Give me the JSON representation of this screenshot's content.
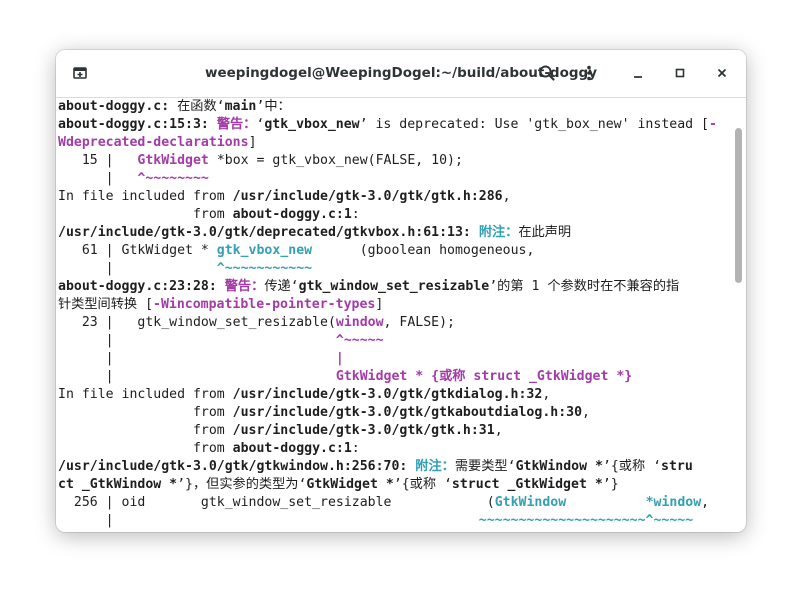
{
  "window": {
    "title": "weepingdogel@WeepingDogel:~/build/about-doggy",
    "new_tab_icon": "new-tab-icon",
    "search_icon": "search-icon",
    "menu_icon": "kebab-menu-icon",
    "minimize_icon": "minimize-icon",
    "maximize_icon": "maximize-icon",
    "close_icon": "close-icon"
  },
  "colors": {
    "warning": "#a33ba8",
    "note": "#33a0b3",
    "text": "#1e1e1e"
  },
  "terminal": {
    "lines": [
      [
        {
          "t": "about-doggy.c:",
          "c": "b"
        },
        {
          "t": " 在函数‘"
        },
        {
          "t": "main",
          "c": "b"
        },
        {
          "t": "’中："
        }
      ],
      [
        {
          "t": "about-doggy.c:15:3:",
          "c": "b"
        },
        {
          "t": " "
        },
        {
          "t": "警告：",
          "c": "warn"
        },
        {
          "t": "‘"
        },
        {
          "t": "gtk_vbox_new",
          "c": "b"
        },
        {
          "t": "’ is deprecated: Use 'gtk_box_new' instead ["
        },
        {
          "t": "-",
          "c": "magb"
        }
      ],
      [
        {
          "t": "Wdeprecated-declarations",
          "c": "magb"
        },
        {
          "t": "]"
        }
      ],
      [
        {
          "t": "   15 |   "
        },
        {
          "t": "GtkWidget",
          "c": "magb"
        },
        {
          "t": " *box = gtk_vbox_new(FALSE, 10);"
        }
      ],
      [
        {
          "t": "      |   "
        },
        {
          "t": "^~~~~~~~~",
          "c": "magb"
        }
      ],
      [
        {
          "t": "In file included from "
        },
        {
          "t": "/usr/include/gtk-3.0/gtk/gtk.h:286",
          "c": "b"
        },
        {
          "t": ","
        }
      ],
      [
        {
          "t": "                 from "
        },
        {
          "t": "about-doggy.c:1",
          "c": "b"
        },
        {
          "t": ":"
        }
      ],
      [
        {
          "t": "/usr/include/gtk-3.0/gtk/deprecated/gtkvbox.h:61:13:",
          "c": "b"
        },
        {
          "t": " "
        },
        {
          "t": "附注：",
          "c": "note"
        },
        {
          "t": "在此声明"
        }
      ],
      [
        {
          "t": "   61 | GtkWidget * "
        },
        {
          "t": "gtk_vbox_new",
          "c": "note"
        },
        {
          "t": "      (gboolean homogeneous,"
        }
      ],
      [
        {
          "t": "      |             "
        },
        {
          "t": "^~~~~~~~~~~~",
          "c": "note"
        }
      ],
      [
        {
          "t": "about-doggy.c:23:28:",
          "c": "b"
        },
        {
          "t": " "
        },
        {
          "t": "警告：",
          "c": "warn"
        },
        {
          "t": "传递‘"
        },
        {
          "t": "gtk_window_set_resizable",
          "c": "b"
        },
        {
          "t": "’的第 1 个参数时在不兼容的指"
        }
      ],
      [
        {
          "t": "针类型间转换 ["
        },
        {
          "t": "-Wincompatible-pointer-types",
          "c": "magb"
        },
        {
          "t": "]"
        }
      ],
      [
        {
          "t": "   23 |   gtk_window_set_resizable("
        },
        {
          "t": "window",
          "c": "magb"
        },
        {
          "t": ", FALSE);"
        }
      ],
      [
        {
          "t": "      |                            "
        },
        {
          "t": "^~~~~~",
          "c": "magb"
        }
      ],
      [
        {
          "t": "      |                            "
        },
        {
          "t": "|",
          "c": "magb"
        }
      ],
      [
        {
          "t": "      |                            "
        },
        {
          "t": "GtkWidget * {或称 struct _GtkWidget *}",
          "c": "magb"
        }
      ],
      [
        {
          "t": "In file included from "
        },
        {
          "t": "/usr/include/gtk-3.0/gtk/gtkdialog.h:32",
          "c": "b"
        },
        {
          "t": ","
        }
      ],
      [
        {
          "t": "                 from "
        },
        {
          "t": "/usr/include/gtk-3.0/gtk/gtkaboutdialog.h:30",
          "c": "b"
        },
        {
          "t": ","
        }
      ],
      [
        {
          "t": "                 from "
        },
        {
          "t": "/usr/include/gtk-3.0/gtk/gtk.h:31",
          "c": "b"
        },
        {
          "t": ","
        }
      ],
      [
        {
          "t": "                 from "
        },
        {
          "t": "about-doggy.c:1",
          "c": "b"
        },
        {
          "t": ":"
        }
      ],
      [
        {
          "t": "/usr/include/gtk-3.0/gtk/gtkwindow.h:256:70:",
          "c": "b"
        },
        {
          "t": " "
        },
        {
          "t": "附注：",
          "c": "note"
        },
        {
          "t": "需要类型‘"
        },
        {
          "t": "GtkWindow *",
          "c": "b"
        },
        {
          "t": "’{或称 ‘"
        },
        {
          "t": "stru",
          "c": "b"
        }
      ],
      [
        {
          "t": "ct _GtkWindow *",
          "c": "b"
        },
        {
          "t": "’}，但实参的类型为‘"
        },
        {
          "t": "GtkWidget *",
          "c": "b"
        },
        {
          "t": "’{或称 ‘"
        },
        {
          "t": "struct _GtkWidget *",
          "c": "b"
        },
        {
          "t": "’}"
        }
      ],
      [
        {
          "t": "  256 | oid       gtk_window_set_resizable            ("
        },
        {
          "t": "GtkWindow",
          "c": "note"
        },
        {
          "t": "          "
        },
        {
          "t": "*window",
          "c": "note"
        },
        {
          "t": ","
        }
      ],
      [
        {
          "t": "      |                                              "
        },
        {
          "t": "~~~~~~~~~~~~~~~~~~~~~^~~~~~",
          "c": "note"
        }
      ],
      [
        {
          "t": "      |"
        }
      ]
    ]
  }
}
